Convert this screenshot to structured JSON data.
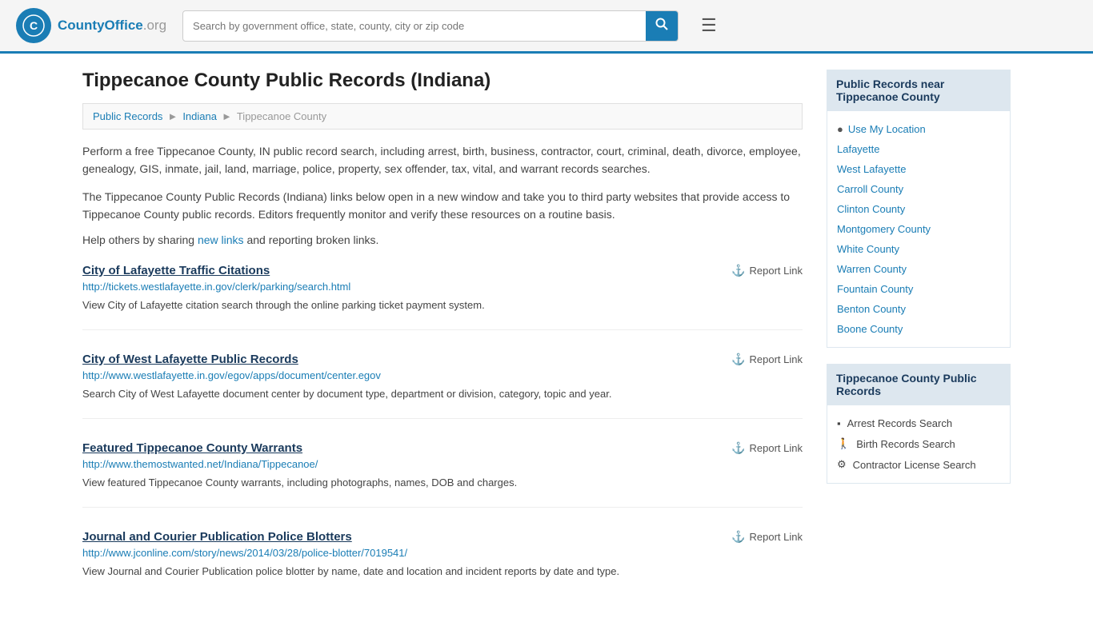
{
  "header": {
    "logo_text": "CountyOffice",
    "logo_suffix": ".org",
    "search_placeholder": "Search by government office, state, county, city or zip code"
  },
  "page": {
    "title": "Tippecanoe County Public Records (Indiana)",
    "breadcrumbs": [
      {
        "label": "Public Records",
        "href": "#"
      },
      {
        "label": "Indiana",
        "href": "#"
      },
      {
        "label": "Tippecanoe County",
        "href": "#"
      }
    ],
    "intro_paragraph1": "Perform a free Tippecanoe County, IN public record search, including arrest, birth, business, contractor, court, criminal, death, divorce, employee, genealogy, GIS, inmate, jail, land, marriage, police, property, sex offender, tax, vital, and warrant records searches.",
    "intro_paragraph2": "The Tippecanoe County Public Records (Indiana) links below open in a new window and take you to third party websites that provide access to Tippecanoe County public records. Editors frequently monitor and verify these resources on a routine basis.",
    "share_text": "Help others by sharing",
    "share_link_text": "new links",
    "share_suffix": "and reporting broken links."
  },
  "records": [
    {
      "title": "City of Lafayette Traffic Citations",
      "url": "http://tickets.westlafayette.in.gov/clerk/parking/search.html",
      "description": "View City of Lafayette citation search through the online parking ticket payment system.",
      "report_label": "Report Link"
    },
    {
      "title": "City of West Lafayette Public Records",
      "url": "http://www.westlafayette.in.gov/egov/apps/document/center.egov",
      "description": "Search City of West Lafayette document center by document type, department or division, category, topic and year.",
      "report_label": "Report Link"
    },
    {
      "title": "Featured Tippecanoe County Warrants",
      "url": "http://www.themostwanted.net/Indiana/Tippecanoe/",
      "description": "View featured Tippecanoe County warrants, including photographs, names, DOB and charges.",
      "report_label": "Report Link"
    },
    {
      "title": "Journal and Courier Publication Police Blotters",
      "url": "http://www.jconline.com/story/news/2014/03/28/police-blotter/7019541/",
      "description": "View Journal and Courier Publication police blotter by name, date and location and incident reports by date and type.",
      "report_label": "Report Link"
    }
  ],
  "sidebar": {
    "nearby_section": {
      "header": "Public Records near Tippecanoe County",
      "use_my_location": "Use My Location",
      "links": [
        {
          "label": "Lafayette"
        },
        {
          "label": "West Lafayette"
        },
        {
          "label": "Carroll County"
        },
        {
          "label": "Clinton County"
        },
        {
          "label": "Montgomery County"
        },
        {
          "label": "White County"
        },
        {
          "label": "Warren County"
        },
        {
          "label": "Fountain County"
        },
        {
          "label": "Benton County"
        },
        {
          "label": "Boone County"
        }
      ]
    },
    "records_section": {
      "header": "Tippecanoe County Public Records",
      "links": [
        {
          "label": "Arrest Records Search",
          "icon": "▪"
        },
        {
          "label": "Birth Records Search",
          "icon": "🚶"
        },
        {
          "label": "Contractor License Search",
          "icon": "⚙"
        }
      ]
    }
  }
}
